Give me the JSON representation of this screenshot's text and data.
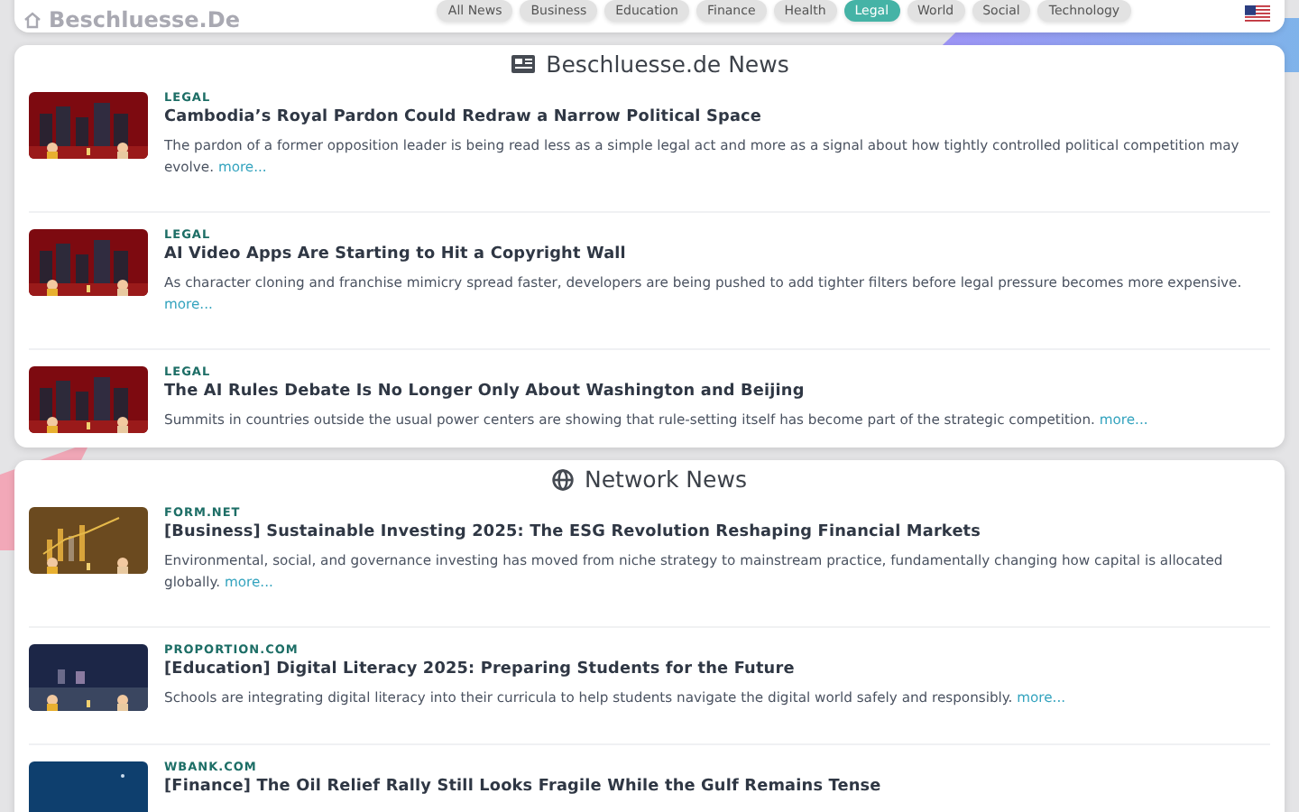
{
  "header": {
    "logo": "Beschluesse.De",
    "nav": [
      {
        "label": "All News",
        "selected": false
      },
      {
        "label": "Business",
        "selected": false
      },
      {
        "label": "Education",
        "selected": false
      },
      {
        "label": "Finance",
        "selected": false
      },
      {
        "label": "Health",
        "selected": false
      },
      {
        "label": "Legal",
        "selected": true
      },
      {
        "label": "World",
        "selected": false
      },
      {
        "label": "Social",
        "selected": false
      },
      {
        "label": "Technology",
        "selected": false
      }
    ]
  },
  "sections": [
    {
      "title": "Beschluesse.de News",
      "kind": "newspaper",
      "items": [
        {
          "category": "LEGAL",
          "kind": "buildings",
          "title": "Cambodia’s Royal Pardon Could Redraw a Narrow Political Space",
          "description": "The pardon of a former opposition leader is being read less as a simple legal act and more as a signal about how tightly controlled political competition may evolve.",
          "more": "more..."
        },
        {
          "category": "LEGAL",
          "kind": "buildings",
          "title": "AI Video Apps Are Starting to Hit a Copyright Wall",
          "description": "As character cloning and franchise mimicry spread faster, developers are being pushed to add tighter filters before legal pressure becomes more expensive.",
          "more": "more..."
        },
        {
          "category": "LEGAL",
          "kind": "buildings",
          "title": "The AI Rules Debate Is No Longer Only About Washington and Beijing",
          "description": "Summits in countries outside the usual power centers are showing that rule-setting itself has become part of the strategic competition.",
          "more": "more..."
        }
      ]
    },
    {
      "title": "Network News",
      "kind": "globe",
      "items": [
        {
          "category": "FORM.NET",
          "kind": "chart",
          "title": "[Business] Sustainable Investing 2025: The ESG Revolution Reshaping Financial Markets",
          "description": "Environmental, social, and governance investing has moved from niche strategy to mainstream practice, fundamentally changing how capital is allocated globally.",
          "more": "more..."
        },
        {
          "category": "PROPORTION.COM",
          "kind": "classroom",
          "title": "[Education] Digital Literacy 2025: Preparing Students for the Future",
          "description": "Schools are integrating digital literacy into their curricula to help students navigate the digital world safely and responsibly.",
          "more": "more..."
        },
        {
          "category": "WBANK.COM",
          "kind": "sky",
          "title": "[Finance] The Oil Relief Rally Still Looks Fragile While the Gulf Remains Tense"
        }
      ]
    }
  ]
}
